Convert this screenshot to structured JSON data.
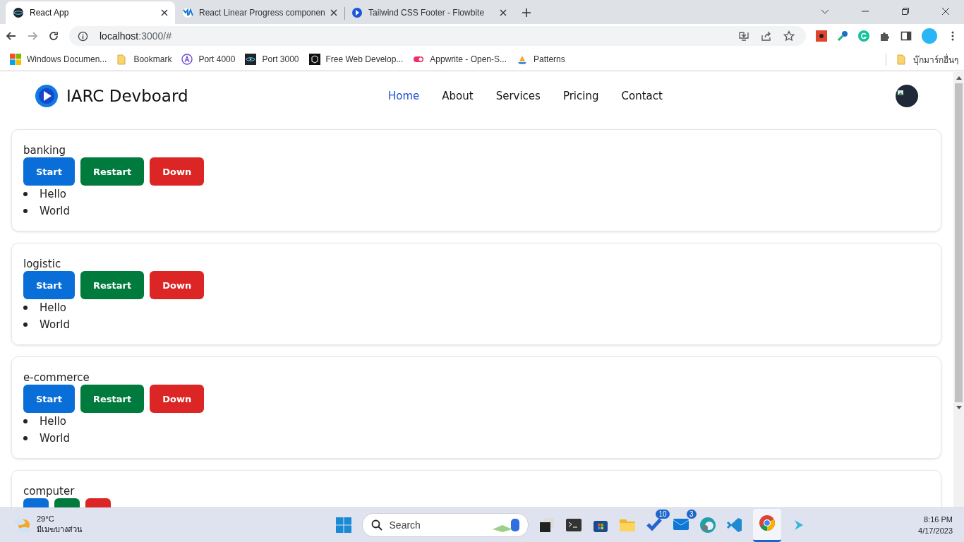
{
  "browser": {
    "tabs": [
      {
        "title": "React App",
        "selected": true
      },
      {
        "title": "React Linear Progress componen",
        "selected": false
      },
      {
        "title": "Tailwind CSS Footer - Flowbite",
        "selected": false
      }
    ],
    "address": {
      "host": "localhost",
      "rest": ":3000/#"
    },
    "bookmarks": [
      "Windows Documen...",
      "Bookmark",
      "Port 4000",
      "Port 3000",
      "Free Web Develop...",
      "Appwrite - Open-S...",
      "Patterns"
    ],
    "other_bookmarks": "บุ๊กมาร์กอื่นๆ"
  },
  "site": {
    "brand": "IARC Devboard",
    "nav": [
      {
        "label": "Home",
        "selected": true
      },
      {
        "label": "About",
        "selected": false
      },
      {
        "label": "Services",
        "selected": false
      },
      {
        "label": "Pricing",
        "selected": false
      },
      {
        "label": "Contact",
        "selected": false
      }
    ]
  },
  "services": [
    {
      "name": "banking",
      "buttons": [
        {
          "kind": "start",
          "label": "Start"
        },
        {
          "kind": "restart",
          "label": "Restart"
        },
        {
          "kind": "down",
          "label": "Down"
        }
      ],
      "items": [
        "Hello",
        "World"
      ]
    },
    {
      "name": "logistic",
      "buttons": [
        {
          "kind": "start",
          "label": "Start"
        },
        {
          "kind": "restart",
          "label": "Restart"
        },
        {
          "kind": "down",
          "label": "Down"
        }
      ],
      "items": [
        "Hello",
        "World"
      ]
    },
    {
      "name": "e-commerce",
      "buttons": [
        {
          "kind": "start",
          "label": "Start"
        },
        {
          "kind": "restart",
          "label": "Restart"
        },
        {
          "kind": "down",
          "label": "Down"
        }
      ],
      "items": [
        "Hello",
        "World"
      ]
    },
    {
      "name": "computer",
      "buttons": [
        {
          "kind": "start"
        },
        {
          "kind": "restart"
        },
        {
          "kind": "down"
        }
      ]
    }
  ],
  "taskbar": {
    "temperature": "29°C",
    "weather": "มีเมฆบางส่วน",
    "search_placeholder": "Search",
    "todo_badge": "10",
    "mail_badge": "3",
    "time": "8:16 PM",
    "date": "4/17/2023"
  }
}
